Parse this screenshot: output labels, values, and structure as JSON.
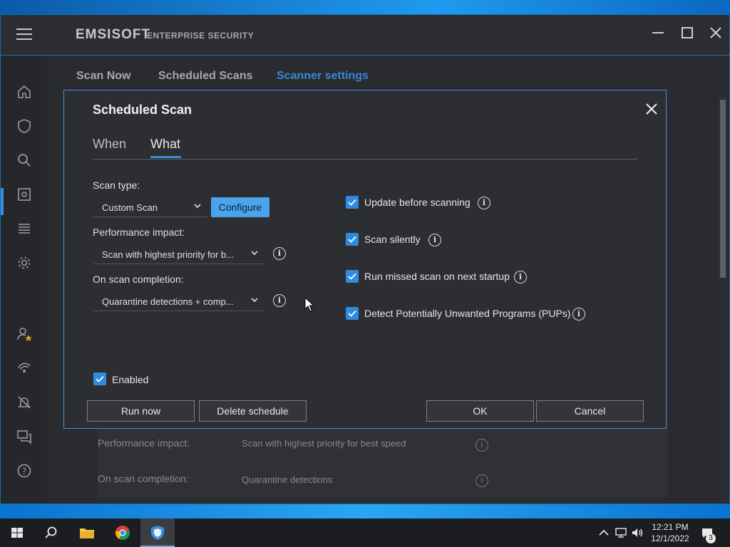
{
  "app": {
    "brand": "EMSISOFT",
    "brand_sub": "ENTERPRISE SECURITY"
  },
  "main_tabs": [
    {
      "label": "Scan Now"
    },
    {
      "label": "Scheduled Scans"
    },
    {
      "label": "Scanner settings"
    }
  ],
  "background_rows": [
    {
      "label": "Performance impact:",
      "value": "Scan with highest priority for best speed"
    },
    {
      "label": "On scan completion:",
      "value": "Quarantine detections"
    }
  ],
  "dialog": {
    "title": "Scheduled Scan",
    "tabs": [
      {
        "label": "When"
      },
      {
        "label": "What"
      }
    ],
    "active_tab": "What",
    "scan_type": {
      "label": "Scan type:",
      "value": "Custom Scan",
      "configure_label": "Configure"
    },
    "performance": {
      "label": "Performance impact:",
      "value": "Scan with highest priority for b..."
    },
    "completion": {
      "label": "On scan completion:",
      "value": "Quarantine detections + comp..."
    },
    "options": [
      {
        "label": "Update before scanning",
        "checked": true
      },
      {
        "label": "Scan silently",
        "checked": true
      },
      {
        "label": "Run missed scan on next startup",
        "checked": true
      },
      {
        "label": "Detect Potentially Unwanted Programs (PUPs)",
        "checked": true
      }
    ],
    "enabled": {
      "label": "Enabled",
      "checked": true
    },
    "buttons": {
      "run_now": "Run now",
      "delete_schedule": "Delete schedule",
      "ok": "OK",
      "cancel": "Cancel"
    }
  },
  "taskbar": {
    "time": "12:21 PM",
    "date": "12/1/2022",
    "notifications": "3"
  },
  "colors": {
    "accent": "#3b8de0",
    "configure_button": "#4aa4ec",
    "checkbox": "#2f8be0",
    "window_bg": "#2b2d30"
  }
}
